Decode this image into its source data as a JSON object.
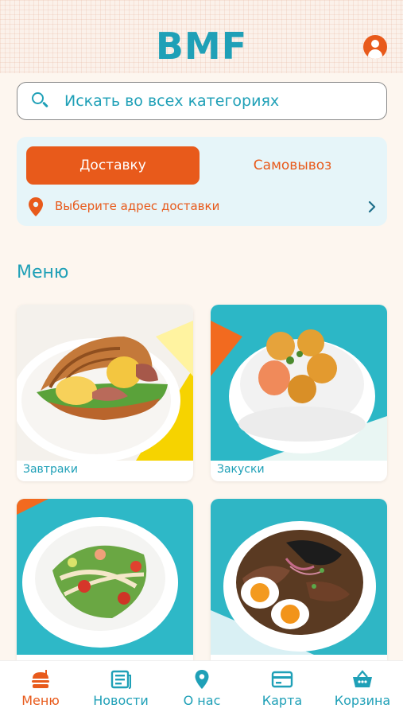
{
  "app": {
    "logo": "BMF"
  },
  "search": {
    "placeholder": "Искать во всех категориях"
  },
  "delivery": {
    "tab_delivery": "Доставку",
    "tab_pickup": "Самовывоз",
    "address_prompt": "Выберите адрес доставки"
  },
  "menu": {
    "title": "Меню",
    "categories": [
      {
        "label": "Завтраки"
      },
      {
        "label": "Закуски"
      },
      {
        "label": ""
      },
      {
        "label": ""
      }
    ]
  },
  "tabbar": {
    "items": [
      {
        "label": "Меню",
        "icon": "burger-icon",
        "active": true
      },
      {
        "label": "Новости",
        "icon": "news-icon",
        "active": false
      },
      {
        "label": "О нас",
        "icon": "location-pin-icon",
        "active": false
      },
      {
        "label": "Карта",
        "icon": "card-icon",
        "active": false
      },
      {
        "label": "Корзина",
        "icon": "basket-icon",
        "active": false
      }
    ]
  },
  "colors": {
    "accent_orange": "#e85a1b",
    "accent_teal": "#1fa0b7",
    "background": "#fdf6ef",
    "card_blue": "#e6f5f9"
  }
}
